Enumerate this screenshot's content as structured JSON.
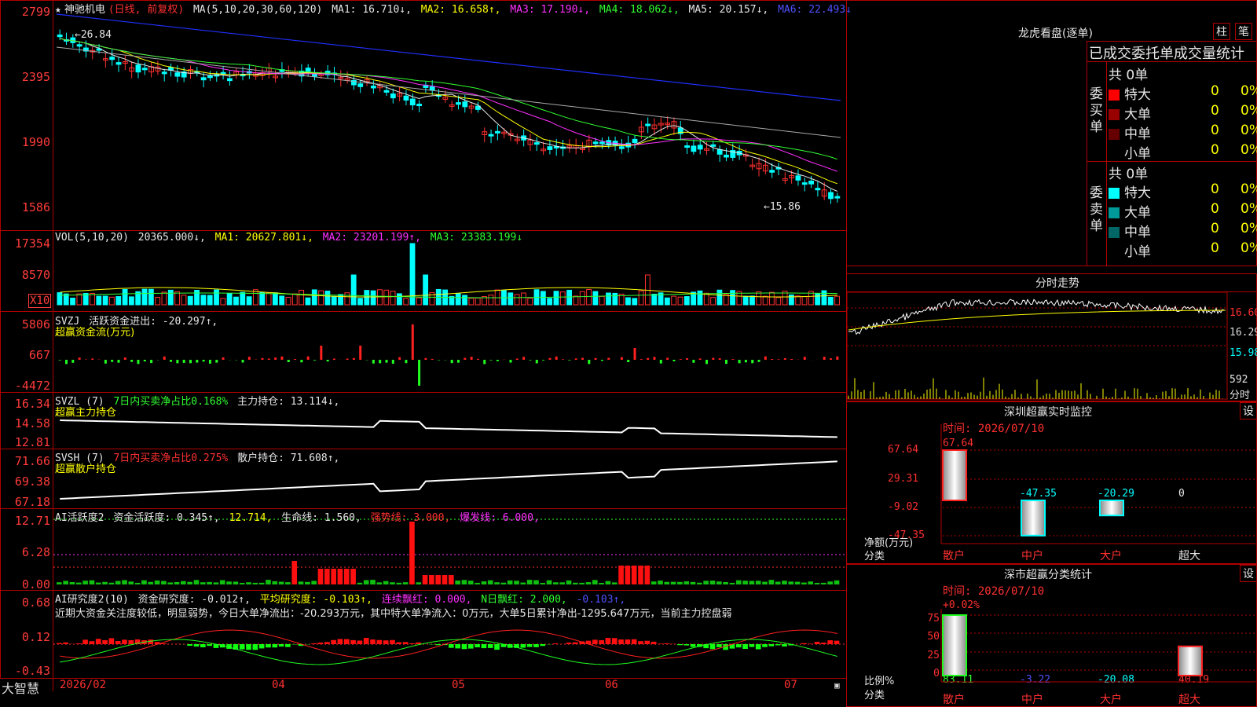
{
  "app_name": "大智慧",
  "kline": {
    "stock_name": "神驰机电",
    "period": "(日线, 前复权)",
    "ma_title": "MA(5,10,20,30,60,120)",
    "ma1": "MA1: 16.710↓,",
    "ma2": "MA2: 16.658↑,",
    "ma3": "MA3: 17.190↓,",
    "ma4": "MA4: 18.062↓,",
    "ma5": "MA5: 20.157↓,",
    "ma6": "MA6: 22.493↓",
    "axis": [
      "2799",
      "2395",
      "1990",
      "1586"
    ],
    "high_label": "←26.84",
    "low_label": "←15.86"
  },
  "vol": {
    "title": "VOL(5,10,20)",
    "value": "20365.000↓,",
    "ma1": "MA1: 20627.801↓,",
    "ma2": "MA2: 23201.199↑,",
    "ma3": "MA3: 23383.199↓",
    "axis": [
      "17354",
      "8570"
    ],
    "unit": "X10"
  },
  "svzj": {
    "title": "SVZJ",
    "line": "活跃资金进出: -20.297↑,",
    "sub": "超赢资金流(万元)",
    "axis": [
      "5806",
      "667",
      "-4472"
    ]
  },
  "svzl": {
    "title": "SVZL (7)",
    "ratio": "7日内买卖净占比0.168%",
    "hold": "主力持仓: 13.114↓,",
    "sub": "超赢主力持仓",
    "axis": [
      "16.34",
      "14.58",
      "12.81"
    ]
  },
  "svsh": {
    "title": "SVSH (7)",
    "ratio": "7日内买卖净占比0.275%",
    "hold": "散户持仓: 71.608↑,",
    "sub": "超赢散户持仓",
    "axis": [
      "71.66",
      "69.38",
      "67.18"
    ]
  },
  "ai_active": {
    "title": "AI活跃度2",
    "l1": "资金活跃度: 0.345↑,",
    "l2": "12.714,",
    "l3": "生命线: 1.560,",
    "l4": "强势线: 3.000,",
    "l5": "爆发线: 6.000,",
    "axis": [
      "12.71",
      "6.28",
      "0.00"
    ]
  },
  "ai_research": {
    "title": "AI研究度2(10)",
    "l1": "资金研究度: -0.012↑,",
    "l2": "平均研究度: -0.103↑,",
    "l3": "连续飘红: 0.000,",
    "l4": "N日飘红: 2.000,",
    "l5": "-0.103↑,",
    "comment": "近期大资金关注度较低，明显弱势，今日大单净流出：-20.293万元，其中特大单净流入：0万元，大单5日累计净出-1295.647万元，当前主力控盘弱",
    "axis": [
      "0.68",
      "0.12",
      "-0.43"
    ]
  },
  "date_axis": [
    "2026/02",
    "04",
    "05",
    "06",
    "07"
  ],
  "lhb": {
    "title": "龙虎看盘(逐单)",
    "btn1": "柱",
    "btn2": "笔",
    "subtitle": "已成交委托单成交量统计",
    "buy_label": "委买单",
    "sell_label": "委卖单",
    "buy_total": "共 0单",
    "sell_total": "共 0单",
    "rows": [
      {
        "label": "特大",
        "count": "0",
        "pct": "0%"
      },
      {
        "label": "大单",
        "count": "0",
        "pct": "0%"
      },
      {
        "label": "中单",
        "count": "0",
        "pct": "0%"
      },
      {
        "label": "小单",
        "count": "0",
        "pct": "0%"
      }
    ],
    "colors": {
      "buy": [
        "#ff0000",
        "#990000",
        "#660000",
        "#000000"
      ],
      "sell": [
        "#00ffff",
        "#009999",
        "#006666",
        "#000000"
      ]
    }
  },
  "intraday": {
    "title": "分时走势",
    "axis": [
      "16.60",
      "16.29",
      "15.98"
    ],
    "vol_label": "592",
    "vol_unit": "分时"
  },
  "sz_monitor": {
    "title": "深圳超赢实时监控",
    "btn": "设",
    "time": "时间: 2026/07/10",
    "axis": [
      "67.64",
      "29.31",
      "-9.02",
      "-47.35"
    ],
    "y_unit": "净额(万元)",
    "cat_label": "分类",
    "values": [
      {
        "name": "散户",
        "value": 67.64,
        "label": "67.64"
      },
      {
        "name": "中户",
        "value": -47.35,
        "label": "-47.35"
      },
      {
        "name": "大户",
        "value": -20.29,
        "label": "-20.29"
      },
      {
        "name": "超大",
        "value": 0,
        "label": "0"
      }
    ]
  },
  "sz_class": {
    "title": "深市超赢分类统计",
    "btn": "设",
    "time": "时间: 2026/07/10",
    "top_pct": "+0.02%",
    "axis": [
      "75",
      "50",
      "25",
      "0"
    ],
    "y_unit": "比例%",
    "cat_label": "分类",
    "values": [
      {
        "name": "散户",
        "value": 83.11,
        "label": "83.11"
      },
      {
        "name": "中户",
        "value": -3.22,
        "label": "-3.22"
      },
      {
        "name": "大户",
        "value": -20.08,
        "label": "-20.08"
      },
      {
        "name": "超大",
        "value": 40.19,
        "label": "40.19"
      }
    ]
  }
}
